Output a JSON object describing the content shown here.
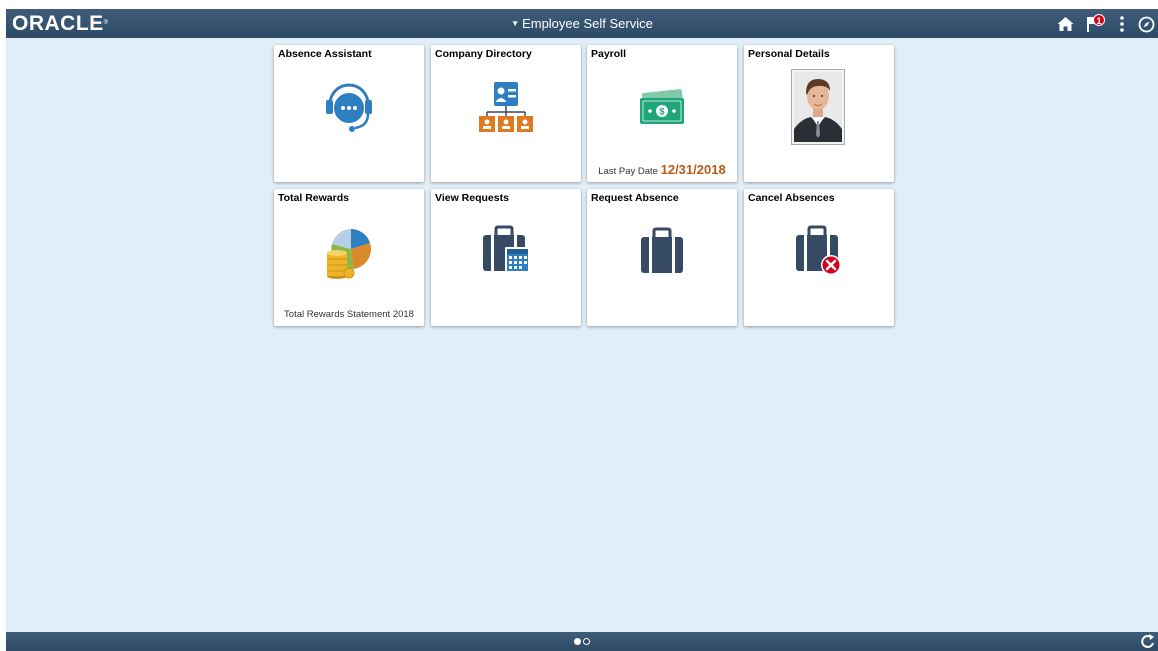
{
  "header": {
    "logo_text": "ORACLE",
    "logo_mark": "®",
    "title": "Employee Self Service",
    "icons": {
      "home": "home-icon",
      "notifications": "flag-icon",
      "actions": "more-vertical-icon",
      "navbar": "compass-icon"
    },
    "notification_count": "1"
  },
  "tiles": [
    {
      "title": "Absence Assistant",
      "icon": "headset-chat-icon"
    },
    {
      "title": "Company Directory",
      "icon": "org-chart-icon"
    },
    {
      "title": "Payroll",
      "icon": "money-icon",
      "footer_label": "Last Pay Date",
      "footer_value": "12/31/2018"
    },
    {
      "title": "Personal Details",
      "icon": "employee-photo"
    },
    {
      "title": "Total Rewards",
      "icon": "pie-coins-icon",
      "footer_label": "Total Rewards Statement 2018"
    },
    {
      "title": "View Requests",
      "icon": "briefcase-calendar-icon"
    },
    {
      "title": "Request Absence",
      "icon": "briefcase-icon"
    },
    {
      "title": "Cancel Absences",
      "icon": "briefcase-cancel-icon"
    }
  ],
  "footer": {
    "page_count": 2,
    "active_page": 1,
    "refresh_icon": "refresh-icon"
  },
  "colors": {
    "banner": "#2d4a66",
    "background": "#e1edf7",
    "accent_orange": "#b85c1a",
    "icon_blue": "#2e7fc1",
    "icon_slate": "#364a63",
    "badge_red": "#d6001c"
  }
}
